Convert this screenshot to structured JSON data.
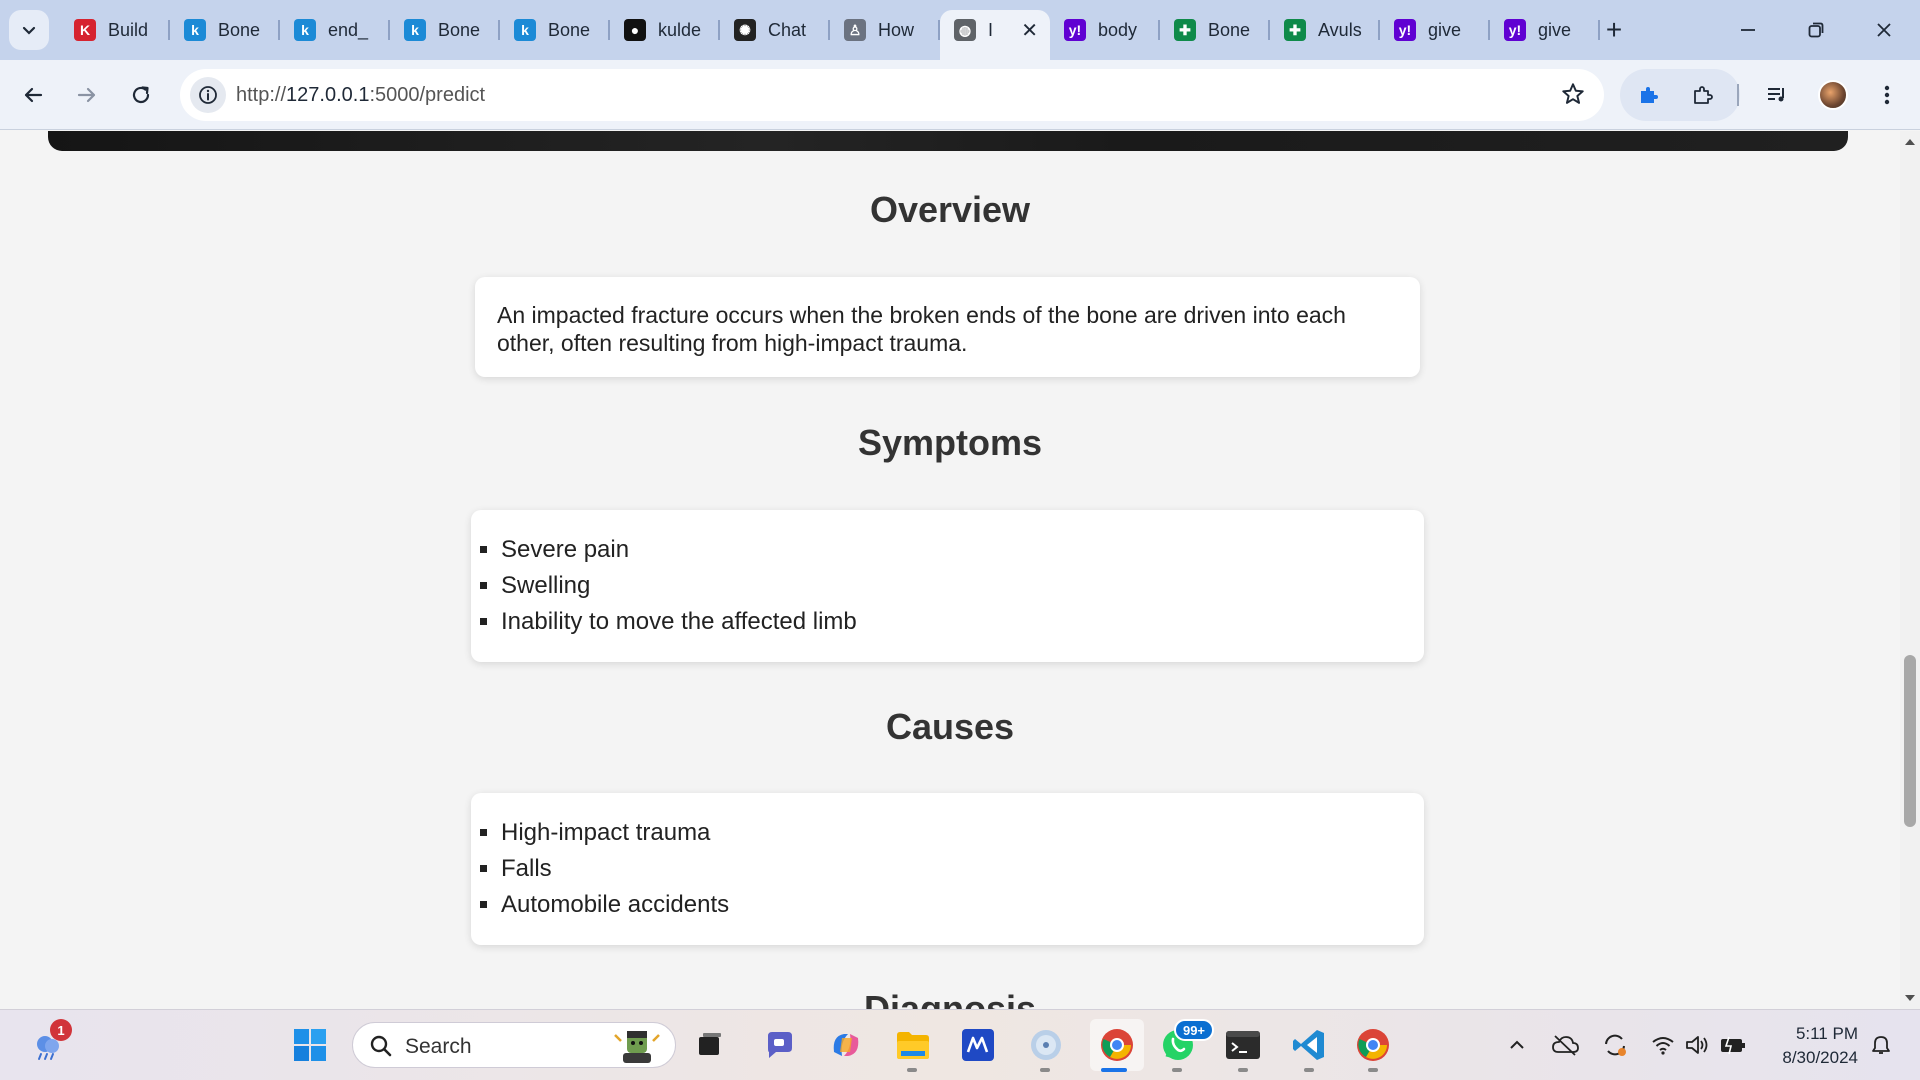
{
  "browser": {
    "tabs": [
      {
        "label": "Build",
        "favicon": "k-red-logo",
        "color": "#d6232f",
        "glyph": "K"
      },
      {
        "label": "Bone",
        "favicon": "k-blue-logo",
        "color": "#1c8ad6",
        "glyph": "k"
      },
      {
        "label": "end_",
        "favicon": "k-blue-logo",
        "color": "#1c8ad6",
        "glyph": "k"
      },
      {
        "label": "Bone",
        "favicon": "k-blue-logo",
        "color": "#1c8ad6",
        "glyph": "k"
      },
      {
        "label": "Bone",
        "favicon": "k-blue-logo",
        "color": "#1c8ad6",
        "glyph": "k"
      },
      {
        "label": "kulde",
        "favicon": "github-icon",
        "color": "#111111",
        "glyph": "●"
      },
      {
        "label": "Chat",
        "favicon": "chatgpt-icon",
        "color": "#222222",
        "glyph": "✺"
      },
      {
        "label": "How",
        "favicon": "person-icon",
        "color": "#6b7280",
        "glyph": "♙"
      },
      {
        "label": "I",
        "favicon": "globe-icon",
        "color": "#5f6368",
        "glyph": "◍",
        "active": true
      },
      {
        "label": "body",
        "favicon": "yahoo-icon",
        "color": "#6001d2",
        "glyph": "y!"
      },
      {
        "label": "Bone",
        "favicon": "medical-cross-icon",
        "color": "#0f8a4a",
        "glyph": "✚"
      },
      {
        "label": "Avuls",
        "favicon": "medical-cross-icon",
        "color": "#0f8a4a",
        "glyph": "✚"
      },
      {
        "label": "give",
        "favicon": "yahoo-icon",
        "color": "#6001d2",
        "glyph": "y!"
      },
      {
        "label": "give",
        "favicon": "yahoo-icon",
        "color": "#6001d2",
        "glyph": "y!"
      }
    ],
    "url_scheme": "http://",
    "url_host": "127.0.0.1",
    "url_rest": ":5000/predict"
  },
  "content": {
    "overview": {
      "title": "Overview",
      "text": "An impacted fracture occurs when the broken ends of the bone are driven into each other, often resulting from high-impact trauma."
    },
    "symptoms": {
      "title": "Symptoms",
      "items": [
        "Severe pain",
        "Swelling",
        "Inability to move the affected limb"
      ]
    },
    "causes": {
      "title": "Causes",
      "items": [
        "High-impact trauma",
        "Falls",
        "Automobile accidents"
      ]
    },
    "diagnosis": {
      "title": "Diagnosis"
    }
  },
  "taskbar": {
    "search_placeholder": "Search",
    "weather_badge": "1",
    "whatsapp_badge": "99+",
    "time": "5:11 PM",
    "date": "8/30/2024"
  },
  "colors": {
    "accent_blue": "#1a73e8",
    "tabstrip": "#c5d3ec",
    "toolbar": "#eef2f9",
    "page_bg": "#f4f4f4"
  }
}
